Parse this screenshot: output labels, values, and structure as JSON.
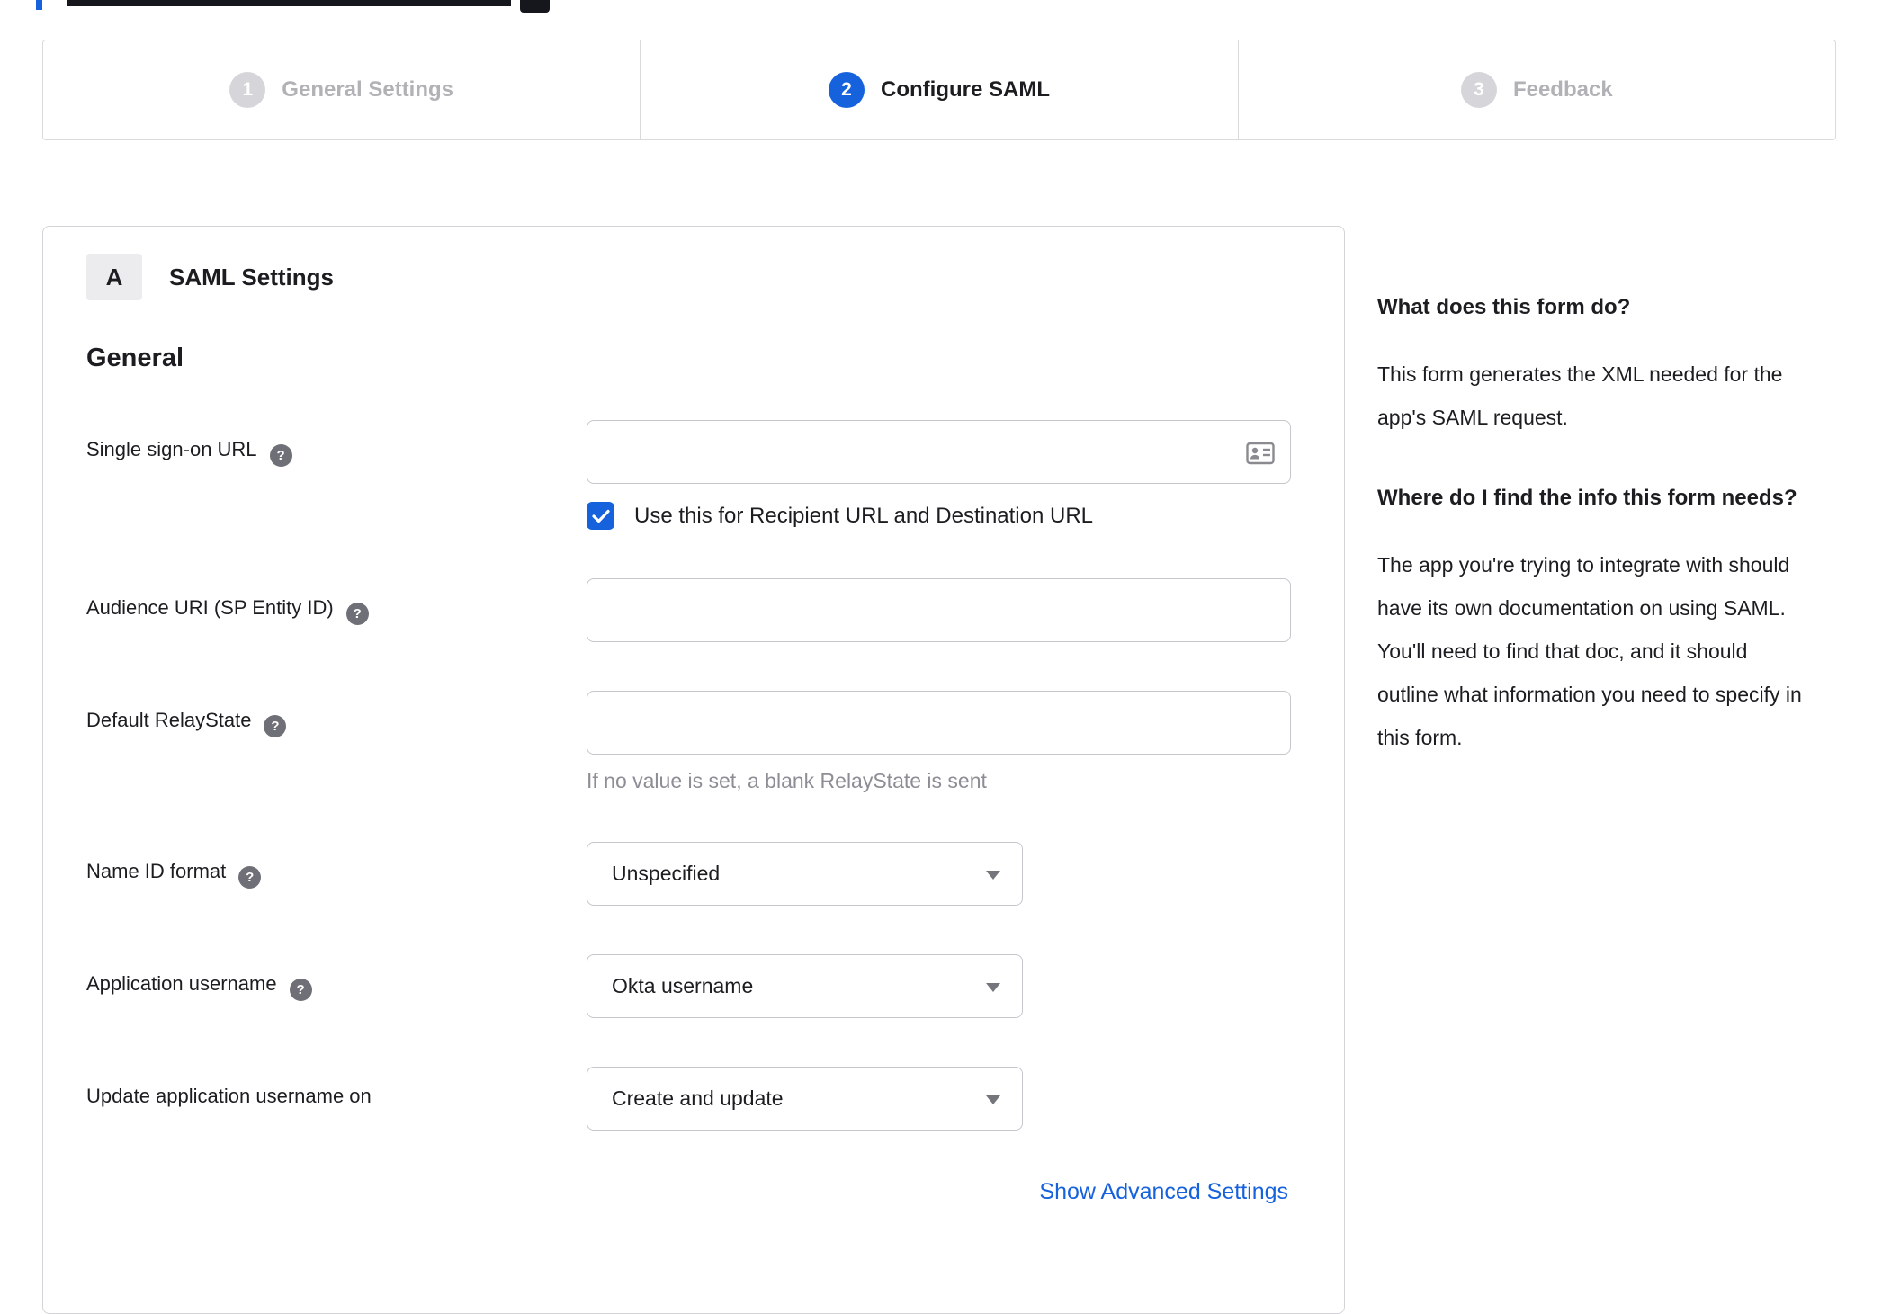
{
  "icons": {
    "help_glyph": "?"
  },
  "colors": {
    "accent_blue": "#1662dd",
    "inactive_gray": "#b1b1b6"
  },
  "stepper": {
    "steps": [
      {
        "number": "1",
        "label": "General Settings",
        "state": "inactive"
      },
      {
        "number": "2",
        "label": "Configure SAML",
        "state": "active"
      },
      {
        "number": "3",
        "label": "Feedback",
        "state": "inactive"
      }
    ]
  },
  "panel": {
    "section_badge": "A",
    "section_title": "SAML Settings",
    "group_heading": "General",
    "fields": {
      "sso_url": {
        "label": "Single sign-on URL",
        "value": ""
      },
      "sso_checkbox": {
        "label": "Use this for Recipient URL and Destination URL",
        "checked": true
      },
      "audience_uri": {
        "label": "Audience URI (SP Entity ID)",
        "value": ""
      },
      "default_relaystate": {
        "label": "Default RelayState",
        "value": "",
        "hint": "If no value is set, a blank RelayState is sent"
      },
      "name_id_format": {
        "label": "Name ID format",
        "value": "Unspecified"
      },
      "application_username": {
        "label": "Application username",
        "value": "Okta username"
      },
      "update_app_username": {
        "label": "Update application username on",
        "value": "Create and update"
      }
    },
    "advanced_link": "Show Advanced Settings"
  },
  "sidebar": {
    "sections": [
      {
        "heading": "What does this form do?",
        "body": "This form generates the XML needed for the app's SAML request."
      },
      {
        "heading": "Where do I find the info this form needs?",
        "body": "The app you're trying to integrate with should have its own documentation on using SAML. You'll need to find that doc, and it should outline what information you need to specify in this form."
      }
    ]
  }
}
